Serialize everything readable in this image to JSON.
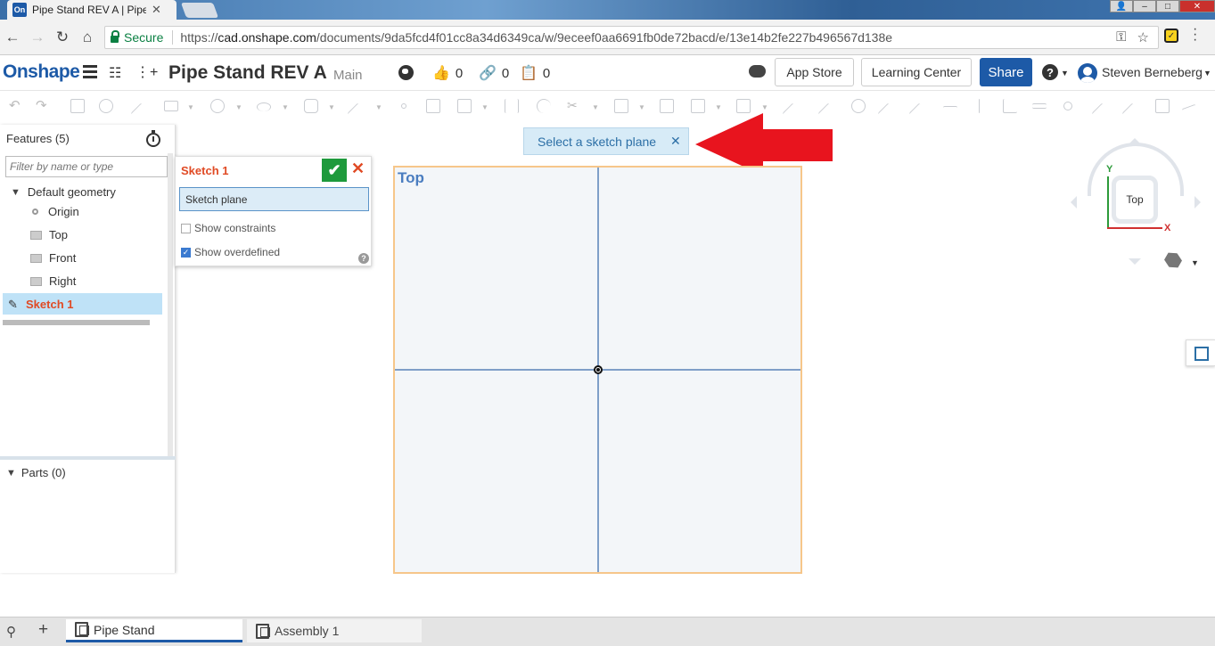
{
  "browser": {
    "tab_title": "Pipe Stand REV A | Pipe S",
    "tab_favicon_text": "On",
    "tab_close": "✕",
    "secure_label": "Secure",
    "url_scheme": "https://",
    "url_host": "cad.onshape.com",
    "url_path": "/documents/9da5fcd4f01cc8a34d6349ca/w/9eceef0aa6691fb0de72bacd/e/13e14b2fe227b496567d138e",
    "nav_back": "←",
    "nav_forward": "→",
    "nav_reload": "↻",
    "nav_home": "⌂",
    "key_icon": "⚿",
    "star_icon": "☆"
  },
  "header": {
    "logo": "Onshape",
    "doc_title": "Pipe Stand REV A",
    "branch": "Main",
    "likes": "0",
    "links": "0",
    "copies": "0",
    "app_store": "App Store",
    "learning_center": "Learning Center",
    "share": "Share",
    "help": "?",
    "user": "Steven Berneberg"
  },
  "feature_panel": {
    "title": "Features (5)",
    "filter_placeholder": "Filter by name or type",
    "default_geometry": "Default geometry",
    "items": [
      "Origin",
      "Top",
      "Front",
      "Right"
    ],
    "sketch": "Sketch 1",
    "parts": "Parts (0)"
  },
  "sketch_dialog": {
    "title": "Sketch 1",
    "plane_field": "Sketch plane",
    "show_constraints": "Show constraints",
    "show_overdefined": "Show overdefined",
    "show_constraints_checked": false,
    "show_overdefined_checked": true
  },
  "notice": {
    "text": "Select a sketch plane",
    "close": "✕"
  },
  "viewport": {
    "plane_label": "Top",
    "viewcube_face": "Top",
    "axis_x": "X",
    "axis_y": "Y"
  },
  "bottom_tabs": [
    {
      "label": "Pipe Stand",
      "active": true
    },
    {
      "label": "Assembly 1",
      "active": false
    }
  ],
  "colors": {
    "brand": "#1d5aa7",
    "sketch_accent": "#e04a24",
    "confirm": "#1e9a3c",
    "annotation_arrow": "#e8141e"
  }
}
